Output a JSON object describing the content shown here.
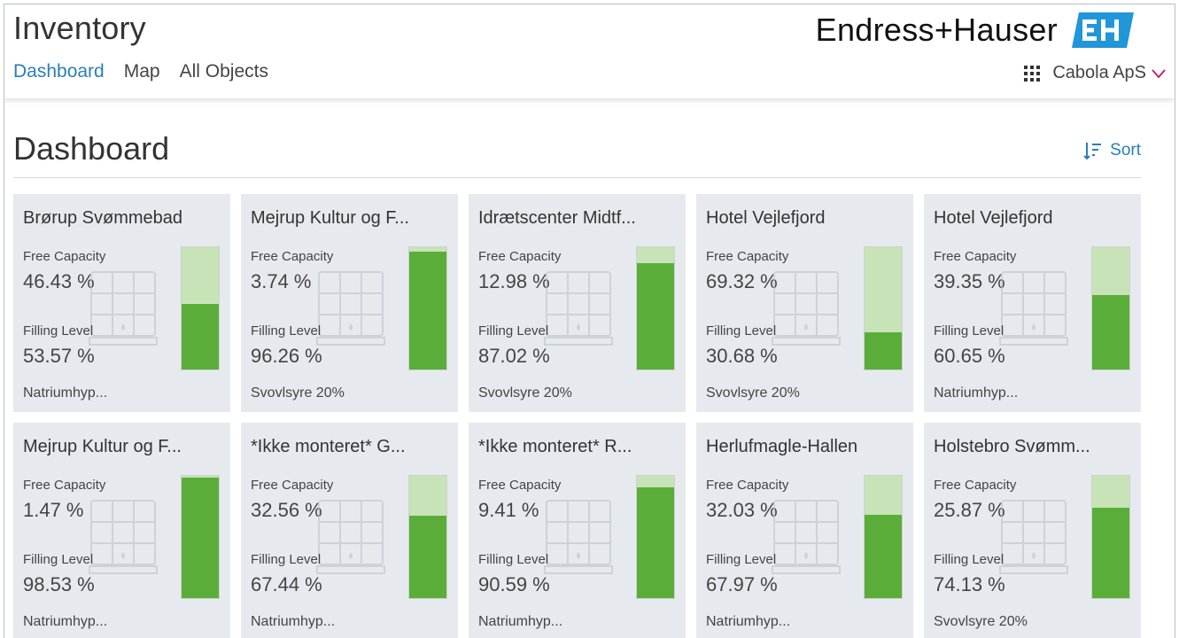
{
  "app": {
    "title": "Inventory",
    "nav": [
      {
        "label": "Dashboard",
        "active": true
      },
      {
        "label": "Map",
        "active": false
      },
      {
        "label": "All Objects",
        "active": false
      }
    ],
    "brand": "Endress+Hauser",
    "account": "Cabola ApS"
  },
  "page": {
    "title": "Dashboard",
    "sort_label": "Sort"
  },
  "labels": {
    "free": "Free Capacity",
    "fill": "Filling Level"
  },
  "colors": {
    "accent": "#2a7fb5",
    "brand_logo": "#2196d8",
    "fill": "#5bad3a",
    "empty": "#c8e3b7",
    "card_bg": "#e6eaee"
  },
  "cards": [
    {
      "title": "Brørup Svømmebad",
      "free": "46.43 %",
      "fill": "53.57 %",
      "level": 53.57,
      "product": "Natriumhyp..."
    },
    {
      "title": "Mejrup Kultur og F...",
      "free": "3.74 %",
      "fill": "96.26 %",
      "level": 96.26,
      "product": "Svovlsyre 20%"
    },
    {
      "title": "Idrætscenter Midtf...",
      "free": "12.98 %",
      "fill": "87.02 %",
      "level": 87.02,
      "product": "Svovlsyre 20%"
    },
    {
      "title": "Hotel Vejlefjord",
      "free": "69.32 %",
      "fill": "30.68 %",
      "level": 30.68,
      "product": "Svovlsyre 20%"
    },
    {
      "title": "Hotel Vejlefjord",
      "free": "39.35 %",
      "fill": "60.65 %",
      "level": 60.65,
      "product": "Natriumhyp..."
    },
    {
      "title": "Mejrup Kultur og F...",
      "free": "1.47 %",
      "fill": "98.53 %",
      "level": 98.53,
      "product": "Natriumhyp..."
    },
    {
      "title": "*Ikke monteret* G...",
      "free": "32.56 %",
      "fill": "67.44 %",
      "level": 67.44,
      "product": "Natriumhyp..."
    },
    {
      "title": "*Ikke monteret* R...",
      "free": "9.41 %",
      "fill": "90.59 %",
      "level": 90.59,
      "product": "Natriumhyp..."
    },
    {
      "title": "Herlufmagle-Hallen",
      "free": "32.03 %",
      "fill": "67.97 %",
      "level": 67.97,
      "product": "Natriumhyp..."
    },
    {
      "title": "Holstebro Svømm...",
      "free": "25.87 %",
      "fill": "74.13 %",
      "level": 74.13,
      "product": "Svovlsyre 20%"
    }
  ]
}
